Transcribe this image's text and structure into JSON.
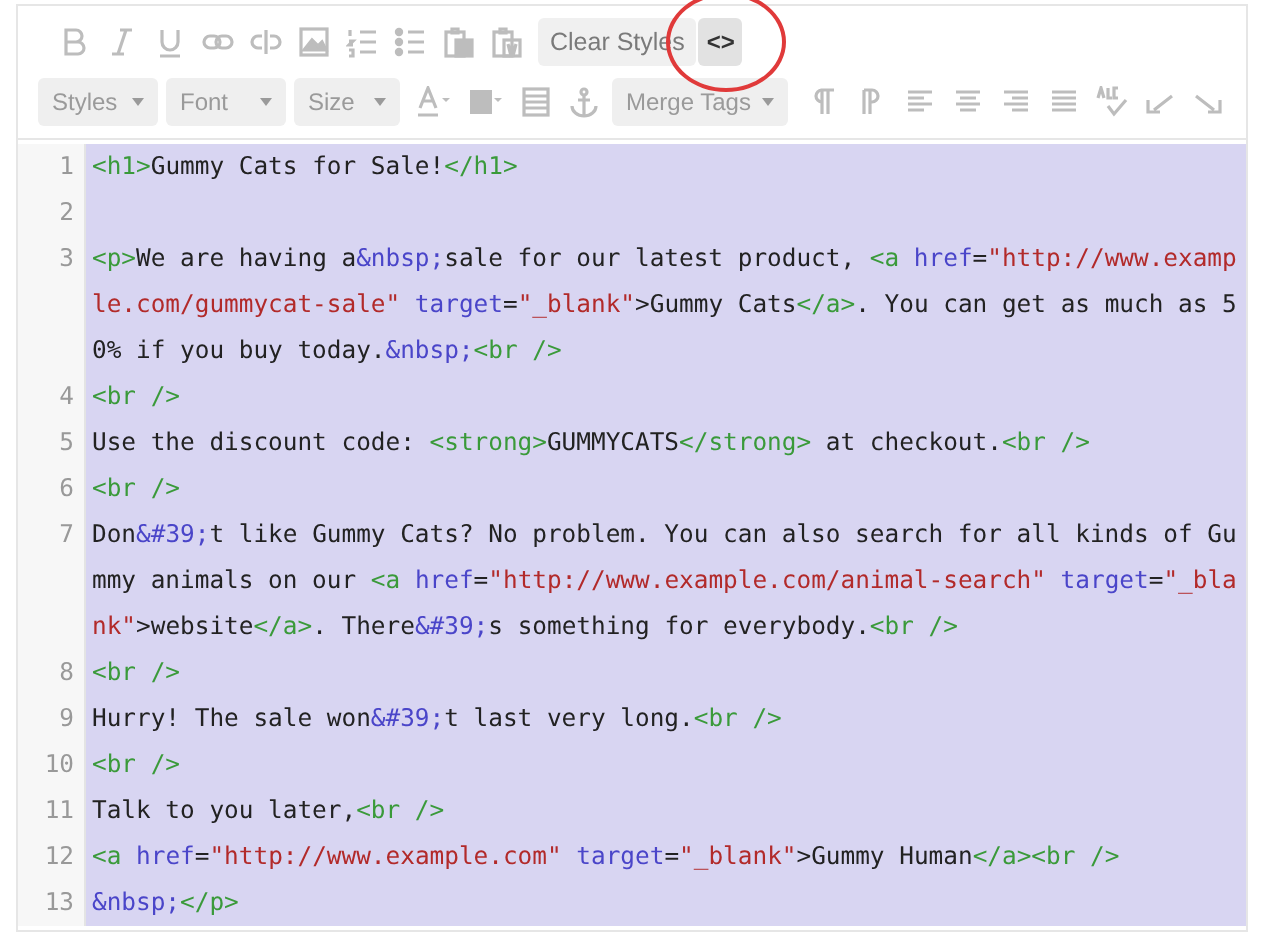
{
  "toolbar": {
    "icons_disabled": true,
    "clear_styles_button": {
      "label": "Clear Styles",
      "disabled": true
    },
    "source_button": {
      "label": "<>",
      "selected": true,
      "circled": true
    },
    "dropdowns": [
      {
        "label": "Styles",
        "disabled": true
      },
      {
        "label": "Font",
        "disabled": true
      },
      {
        "label": "Size",
        "disabled": true
      }
    ],
    "merge_tags": {
      "label": "Merge Tags",
      "disabled": true
    }
  },
  "editor": {
    "selected": true,
    "lines": [
      {
        "number": "1",
        "rows": [
          {
            "tokens": [
              {
                "kind": "tag",
                "text": "<h1>"
              },
              {
                "kind": "text",
                "text": "Gummy Cats for Sale!"
              },
              {
                "kind": "tag",
                "text": "</h1>"
              }
            ]
          }
        ]
      },
      {
        "number": "2",
        "rows": [
          {}
        ]
      },
      {
        "number": "3",
        "rows": [
          {
            "tokens": [
              {
                "kind": "tag",
                "text": "<p>"
              },
              {
                "kind": "text",
                "text": "We are having a"
              },
              {
                "kind": "entity",
                "text": "&nbsp;"
              },
              {
                "kind": "text",
                "text": "sale for our latest product, "
              },
              {
                "kind": "tag",
                "text": "<a"
              },
              {
                "kind": "attr",
                "text": " href"
              },
              {
                "kind": "text",
                "text": "="
              },
              {
                "kind": "string",
                "text": "\"http://www.examp"
              }
            ]
          },
          {
            "tokens": [
              {
                "kind": "string",
                "text": "le.com/gummycat-sale\""
              },
              {
                "kind": "attr",
                "text": " target"
              },
              {
                "kind": "text",
                "text": "="
              },
              {
                "kind": "string",
                "text": "\"_blank\""
              },
              {
                "kind": "text",
                "text": ">Gummy Cats"
              },
              {
                "kind": "tag",
                "text": "</a>"
              },
              {
                "kind": "text",
                "text": ". You can get as much as 5"
              }
            ]
          },
          {
            "tokens": [
              {
                "kind": "text",
                "text": "0% if you buy today."
              },
              {
                "kind": "entity",
                "text": "&nbsp;"
              },
              {
                "kind": "tag",
                "text": "<br />"
              }
            ]
          }
        ]
      },
      {
        "number": "4",
        "rows": [
          {
            "tokens": [
              {
                "kind": "tag",
                "text": "<br />"
              }
            ]
          }
        ]
      },
      {
        "number": "5",
        "rows": [
          {
            "tokens": [
              {
                "kind": "text",
                "text": "Use the discount code: "
              },
              {
                "kind": "tag",
                "text": "<strong>"
              },
              {
                "kind": "text",
                "text": "GUMMYCATS"
              },
              {
                "kind": "tag",
                "text": "</strong>"
              },
              {
                "kind": "text",
                "text": " at checkout."
              },
              {
                "kind": "tag",
                "text": "<br />"
              }
            ]
          }
        ]
      },
      {
        "number": "6",
        "rows": [
          {
            "tokens": [
              {
                "kind": "tag",
                "text": "<br />"
              }
            ]
          }
        ]
      },
      {
        "number": "7",
        "rows": [
          {
            "tokens": [
              {
                "kind": "text",
                "text": "Don"
              },
              {
                "kind": "entity",
                "text": "&#39;"
              },
              {
                "kind": "text",
                "text": "t like Gummy Cats? No problem. You can also search for all kinds of Gu"
              }
            ]
          },
          {
            "tokens": [
              {
                "kind": "text",
                "text": "mmy animals on our "
              },
              {
                "kind": "tag",
                "text": "<a"
              },
              {
                "kind": "attr",
                "text": " href"
              },
              {
                "kind": "text",
                "text": "="
              },
              {
                "kind": "string",
                "text": "\"http://www.example.com/animal-search\""
              },
              {
                "kind": "attr",
                "text": " target"
              },
              {
                "kind": "text",
                "text": "="
              },
              {
                "kind": "string",
                "text": "\"_bla"
              }
            ]
          },
          {
            "tokens": [
              {
                "kind": "string",
                "text": "nk\""
              },
              {
                "kind": "text",
                "text": ">website"
              },
              {
                "kind": "tag",
                "text": "</a>"
              },
              {
                "kind": "text",
                "text": ". There"
              },
              {
                "kind": "entity",
                "text": "&#39;"
              },
              {
                "kind": "text",
                "text": "s something for everybody."
              },
              {
                "kind": "tag",
                "text": "<br />"
              }
            ]
          }
        ]
      },
      {
        "number": "8",
        "rows": [
          {
            "tokens": [
              {
                "kind": "tag",
                "text": "<br />"
              }
            ]
          }
        ]
      },
      {
        "number": "9",
        "rows": [
          {
            "tokens": [
              {
                "kind": "text",
                "text": "Hurry! The sale won"
              },
              {
                "kind": "entity",
                "text": "&#39;"
              },
              {
                "kind": "text",
                "text": "t last very long."
              },
              {
                "kind": "tag",
                "text": "<br />"
              }
            ]
          }
        ]
      },
      {
        "number": "10",
        "rows": [
          {
            "tokens": [
              {
                "kind": "tag",
                "text": "<br />"
              }
            ]
          }
        ]
      },
      {
        "number": "11",
        "rows": [
          {
            "tokens": [
              {
                "kind": "text",
                "text": "Talk to you later,"
              },
              {
                "kind": "tag",
                "text": "<br />"
              }
            ]
          }
        ]
      },
      {
        "number": "12",
        "rows": [
          {
            "tokens": [
              {
                "kind": "tag",
                "text": "<a"
              },
              {
                "kind": "attr",
                "text": " href"
              },
              {
                "kind": "text",
                "text": "="
              },
              {
                "kind": "string",
                "text": "\"http://www.example.com\""
              },
              {
                "kind": "attr",
                "text": " target"
              },
              {
                "kind": "text",
                "text": "="
              },
              {
                "kind": "string",
                "text": "\"_blank\""
              },
              {
                "kind": "text",
                "text": ">Gummy Human"
              },
              {
                "kind": "tag",
                "text": "</a><br />"
              }
            ]
          }
        ]
      },
      {
        "number": "13",
        "rows": [
          {
            "tokens": [
              {
                "kind": "entity",
                "text": "&nbsp;"
              },
              {
                "kind": "tag",
                "text": "</p>"
              }
            ]
          }
        ]
      }
    ]
  }
}
